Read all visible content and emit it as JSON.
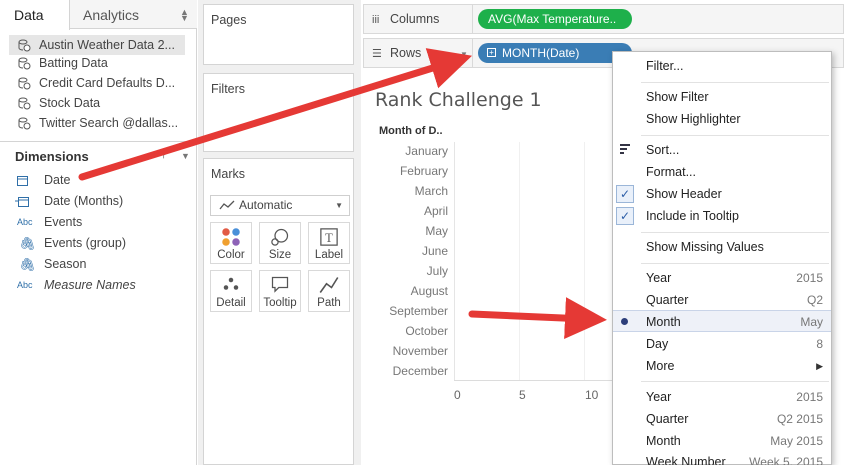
{
  "tabs": {
    "data": "Data",
    "analytics": "Analytics"
  },
  "data_sources": [
    {
      "label": "Austin Weather Data 2...",
      "selected": true
    },
    {
      "label": "Batting Data",
      "selected": false
    },
    {
      "label": "Credit Card Defaults D...",
      "selected": false
    },
    {
      "label": "Stock Data",
      "selected": false
    },
    {
      "label": "Twitter Search @dallas...",
      "selected": false
    }
  ],
  "dimensions": {
    "header": "Dimensions",
    "fields": [
      {
        "label": "Date",
        "icon": "calendar-icon"
      },
      {
        "label": "Date (Months)",
        "icon": "calendar-group-icon"
      },
      {
        "label": "Events",
        "icon": "abc-icon"
      },
      {
        "label": "Events (group)",
        "icon": "paperclip-icon"
      },
      {
        "label": "Season",
        "icon": "paperclip-icon"
      },
      {
        "label": "Measure Names",
        "icon": "abc-icon"
      }
    ]
  },
  "cards": {
    "pages": "Pages",
    "filters": "Filters",
    "marks": "Marks"
  },
  "marks": {
    "type": "Automatic",
    "buttons": [
      "Color",
      "Size",
      "Label",
      "Detail",
      "Tooltip",
      "Path"
    ]
  },
  "shelves": {
    "columns_label": "Columns",
    "columns_pill": "AVG(Max Temperature..",
    "rows_label": "Rows",
    "rows_pill": "MONTH(Date)"
  },
  "view": {
    "title": "Rank Challenge 1",
    "row_header": "Month of D..",
    "months": [
      "January",
      "February",
      "March",
      "April",
      "May",
      "June",
      "July",
      "August",
      "September",
      "October",
      "November",
      "December"
    ],
    "axis_ticks": [
      "0",
      "5",
      "10"
    ]
  },
  "context_menu": {
    "filter": "Filter...",
    "show_filter": "Show Filter",
    "show_highlighter": "Show Highlighter",
    "sort": "Sort...",
    "format": "Format...",
    "show_header": "Show Header",
    "include_in_tooltip": "Include in Tooltip",
    "show_missing_values": "Show Missing Values",
    "year": {
      "label": "Year",
      "value": "2015"
    },
    "quarter": {
      "label": "Quarter",
      "value": "Q2"
    },
    "month": {
      "label": "Month",
      "value": "May"
    },
    "day": {
      "label": "Day",
      "value": "8"
    },
    "more": "More",
    "year2": {
      "label": "Year",
      "value": "2015"
    },
    "quarter2": {
      "label": "Quarter",
      "value": "Q2 2015"
    },
    "month2": {
      "label": "Month",
      "value": "May 2015"
    },
    "week_number": {
      "label": "Week Number",
      "value": "Week 5, 2015"
    }
  },
  "colors": {
    "columns_pill": "#1eb04b",
    "rows_pill": "#3a7db5",
    "annotation_arrow": "#e53935"
  }
}
